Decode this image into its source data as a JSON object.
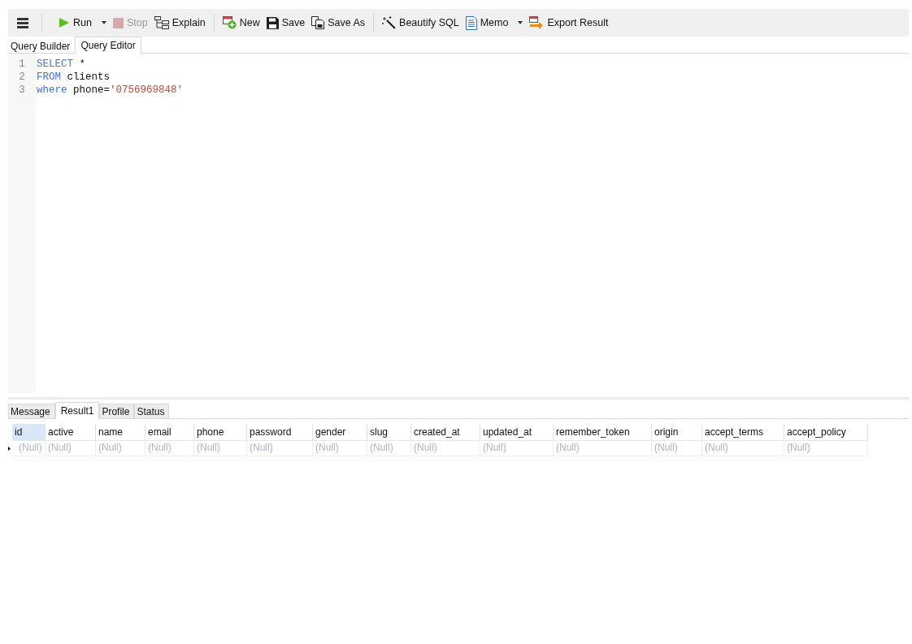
{
  "toolbar": [
    {
      "kind": "menu"
    },
    {
      "kind": "separator"
    },
    {
      "kind": "split",
      "label": "Run",
      "disabled": false
    },
    {
      "kind": "button",
      "label": "Stop",
      "disabled": true
    },
    {
      "kind": "button",
      "label": "Explain",
      "disabled": false
    },
    {
      "kind": "separator"
    },
    {
      "kind": "button",
      "label": "New",
      "disabled": false
    },
    {
      "kind": "button",
      "label": "Save",
      "disabled": false
    },
    {
      "kind": "button",
      "label": "Save As",
      "disabled": false
    },
    {
      "kind": "separator"
    },
    {
      "kind": "button",
      "label": "Beautify SQL",
      "disabled": false
    },
    {
      "kind": "split",
      "label": "Memo",
      "disabled": false
    },
    {
      "kind": "button",
      "label": "Export Result",
      "disabled": false
    }
  ],
  "editor_tabs": [
    {
      "label": "Query Builder",
      "selected": false
    },
    {
      "label": "Query Editor",
      "selected": true
    }
  ],
  "editor": {
    "lines": [
      {
        "number": "1",
        "tokens": [
          {
            "kind": "keyword",
            "text": "SELECT"
          },
          {
            "kind": "plain",
            "text": " *"
          }
        ]
      },
      {
        "number": "2",
        "tokens": [
          {
            "kind": "keyword",
            "text": "FROM"
          },
          {
            "kind": "plain",
            "text": " clients"
          }
        ]
      },
      {
        "number": "3",
        "tokens": [
          {
            "kind": "keyword",
            "text": "where"
          },
          {
            "kind": "plain",
            "text": " phone="
          },
          {
            "kind": "string",
            "text": "'0756969848'"
          }
        ]
      }
    ]
  },
  "result_tabs": [
    {
      "label": "Message",
      "selected": false
    },
    {
      "label": "Result1",
      "selected": true
    },
    {
      "label": "Profile",
      "selected": false
    },
    {
      "label": "Status",
      "selected": false
    }
  ],
  "table": {
    "columns": [
      {
        "label": "id",
        "selected": true
      },
      {
        "label": "active",
        "selected": false
      },
      {
        "label": "name",
        "selected": false
      },
      {
        "label": "email",
        "selected": false
      },
      {
        "label": "phone",
        "selected": false
      },
      {
        "label": "password",
        "selected": false
      },
      {
        "label": "gender",
        "selected": false
      },
      {
        "label": "slug",
        "selected": false
      },
      {
        "label": "created_at",
        "selected": false
      },
      {
        "label": "updated_at",
        "selected": false
      },
      {
        "label": "remember_token",
        "selected": false
      },
      {
        "label": "origin",
        "selected": false
      },
      {
        "label": "accept_terms",
        "selected": false
      },
      {
        "label": "accept_policy",
        "selected": false
      }
    ],
    "rows": [
      {
        "current": true,
        "cells": [
          "(Null)",
          "(Null)",
          "(Null)",
          "(Null)",
          "(Null)",
          "(Null)",
          "(Null)",
          "(Null)",
          "(Null)",
          "(Null)",
          "(Null)",
          "(Null)",
          "(Null)",
          "(Null)"
        ]
      }
    ]
  }
}
